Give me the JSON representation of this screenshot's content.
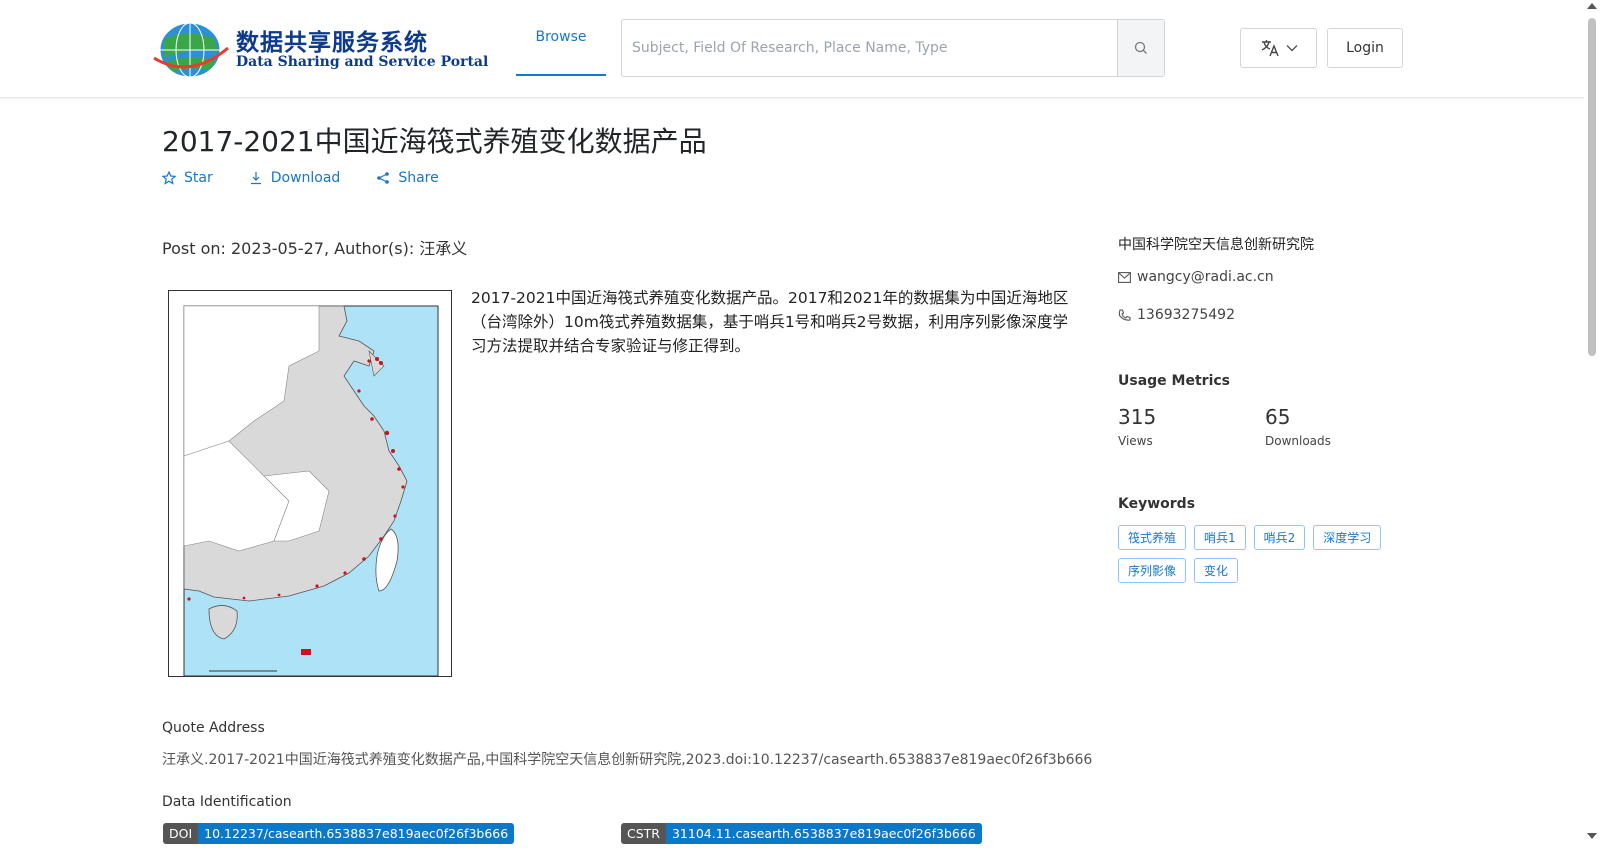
{
  "header": {
    "logo_cn": "数据共享服务系统",
    "logo_en": "Data Sharing and Service Portal",
    "nav_browse": "Browse",
    "search_placeholder": "Subject, Field Of Research, Place Name, Type",
    "login": "Login"
  },
  "dataset": {
    "title": "2017-2021中国近海筏式养殖变化数据产品",
    "actions": {
      "star": "Star",
      "download": "Download",
      "share": "Share"
    },
    "meta": "Post on: 2023-05-27, Author(s): 汪承义",
    "description": "2017-2021中国近海筏式养殖变化数据产品。2017和2021年的数据集为中国近海地区（台湾除外）10m筏式养殖数据集，基于哨兵1号和哨兵2号数据，利用序列影像深度学习方法提取并结合专家验证与修正得到。",
    "quote_label": "Quote Address",
    "quote_text": "汪承义.2017-2021中国近海筏式养殖变化数据产品,中国科学院空天信息创新研究院,2023.doi:10.12237/casearth.6538837e819aec0f26f3b666",
    "ident_label": "Data Identification",
    "doi_key": "DOI",
    "doi_value": "10.12237/casearth.6538837e819aec0f26f3b666",
    "cstr_key": "CSTR",
    "cstr_value": "31104.11.casearth.6538837e819aec0f26f3b666"
  },
  "sidebar": {
    "org": "中国科学院空天信息创新研究院",
    "email": "wangcy@radi.ac.cn",
    "phone": "13693275492",
    "usage_title": "Usage Metrics",
    "views_value": "315",
    "views_label": "Views",
    "downloads_value": "65",
    "downloads_label": "Downloads",
    "keywords_title": "Keywords",
    "keywords": [
      "筏式养殖",
      "哨兵1",
      "哨兵2",
      "深度学习",
      "序列影像",
      "变化"
    ]
  },
  "colors": {
    "accent": "#1677c8",
    "badge_blue": "#0b78c8",
    "badge_gray": "#555555"
  }
}
